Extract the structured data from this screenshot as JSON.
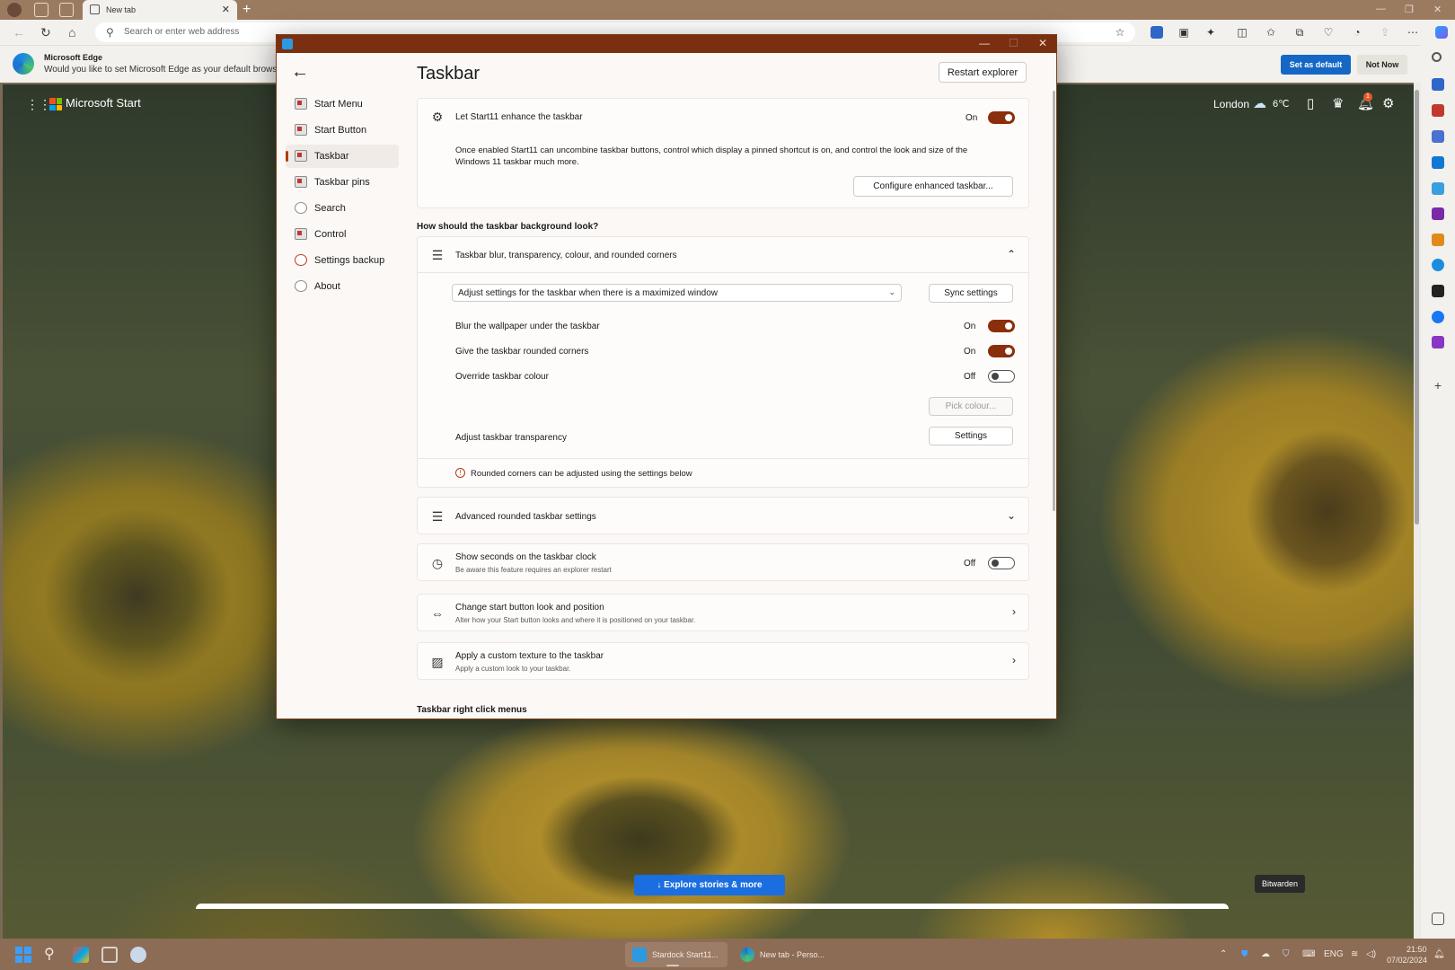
{
  "browser": {
    "tab_title": "New tab",
    "new_tab_symbol": "+",
    "address_placeholder": "Search or enter web address",
    "infobar": {
      "title": "Microsoft Edge",
      "message": "Would you like to set Microsoft Edge as your default browser?",
      "primary_button": "Set as default",
      "secondary_button": "Not Now"
    }
  },
  "ms_start": {
    "brand": "Microsoft Start",
    "weather_city": "London",
    "weather_temp": "6℃",
    "notification_count": "1",
    "explore_button": "Explore stories & more",
    "tooltip": "Bitwarden"
  },
  "app": {
    "nav": [
      {
        "label": "Start Menu",
        "icon": "start-menu-icon"
      },
      {
        "label": "Start Button",
        "icon": "start-button-icon"
      },
      {
        "label": "Taskbar",
        "icon": "taskbar-icon",
        "selected": true
      },
      {
        "label": "Taskbar pins",
        "icon": "taskbar-pins-icon"
      },
      {
        "label": "Search",
        "icon": "search-icon"
      },
      {
        "label": "Control",
        "icon": "control-icon"
      },
      {
        "label": "Settings backup",
        "icon": "settings-backup-icon"
      },
      {
        "label": "About",
        "icon": "info-icon"
      }
    ],
    "page_title": "Taskbar",
    "restart_button": "Restart explorer",
    "enhance": {
      "title": "Let Start11 enhance the taskbar",
      "state": "On",
      "description": "Once enabled Start11 can uncombine taskbar buttons, control which display a pinned shortcut is on, and control the look and size of the Windows 11 taskbar much more.",
      "configure_button": "Configure enhanced taskbar..."
    },
    "background_section": "How should the taskbar background look?",
    "blur_card": {
      "title": "Taskbar blur, transparency, colour, and rounded corners",
      "dropdown_value": "Adjust settings for the taskbar when there is a maximized window",
      "sync_button": "Sync settings",
      "rows": [
        {
          "label": "Blur the wallpaper under the taskbar",
          "state": "On",
          "on": true
        },
        {
          "label": "Give the taskbar rounded corners",
          "state": "On",
          "on": true
        },
        {
          "label": "Override taskbar colour",
          "state": "Off",
          "on": false
        }
      ],
      "pick_colour_button": "Pick colour...",
      "transparency_label": "Adjust taskbar transparency",
      "transparency_button": "Settings",
      "note": "Rounded corners can be adjusted using the settings below"
    },
    "advanced_card": {
      "title": "Advanced rounded taskbar settings"
    },
    "seconds_card": {
      "title": "Show seconds on the taskbar clock",
      "subtitle": "Be aware this feature requires an explorer restart",
      "state": "Off"
    },
    "start_button_card": {
      "title": "Change start button look and position",
      "subtitle": "Alter how your Start button looks and where it is positioned on your taskbar."
    },
    "texture_card": {
      "title": "Apply a custom texture to the taskbar",
      "subtitle": "Apply a custom look to your taskbar."
    },
    "right_click_section": "Taskbar right click menus"
  },
  "taskbar": {
    "apps": [
      {
        "label": "Stardock Start11...",
        "active": true
      },
      {
        "label": "New tab - Perso...",
        "active": false
      }
    ],
    "language": "ENG",
    "time": "21:50",
    "date": "07/02/2024"
  },
  "colors": {
    "accent": "#8a2e0c",
    "edge_blue": "#1467c4",
    "explore_blue": "#1a6ee0",
    "taskbar": "#8c6c55"
  }
}
